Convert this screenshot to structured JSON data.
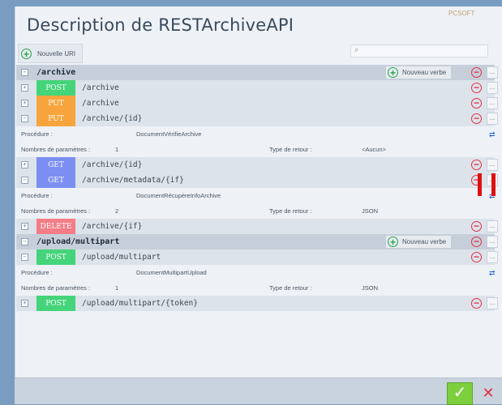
{
  "window": {
    "title": "Description de RESTArchiveAPI",
    "brand": "PCSOFT"
  },
  "toolbar": {
    "new_uri_label": "Nouvelle URI",
    "search_placeholder": ""
  },
  "labels": {
    "add_verb": "Nouveau verbe",
    "procedure": "Procédure :",
    "param_count": "Nombres de paramètres :",
    "return_type": "Type de retour :",
    "dots": "...",
    "expand": "+",
    "collapse": "−"
  },
  "resources": [
    {
      "path": "/archive",
      "verbs": [
        {
          "verb": "POST",
          "color": "#44d47a",
          "path": "/archive",
          "expanded": false
        },
        {
          "verb": "PUT",
          "color": "#f7a43c",
          "path": "/archive",
          "expanded": false
        },
        {
          "verb": "PUT",
          "color": "#f7a43c",
          "path": "/archive/{id}",
          "expanded": true,
          "procedure": "DocumentVérifieArchive",
          "params": "1",
          "return_type": "<Aucun>"
        },
        {
          "verb": "GET",
          "color": "#7b8ef2",
          "path": "/archive/{id}",
          "expanded": false
        },
        {
          "verb": "GET",
          "color": "#7b8ef2",
          "path": "/archive/metadata/{if}",
          "expanded": true,
          "procedure": "DocumentRécupèreInfoArchive",
          "params": "2",
          "return_type": "JSON"
        },
        {
          "verb": "DELETE",
          "color": "#f27d86",
          "path": "/archive/{if}",
          "expanded": false
        }
      ]
    },
    {
      "path": "/upload/multipart",
      "verbs": [
        {
          "verb": "POST",
          "color": "#44d47a",
          "path": "/upload/multipart",
          "expanded": true,
          "procedure": "DocumentMultipartUpload",
          "params": "1",
          "return_type": "JSON"
        },
        {
          "verb": "POST",
          "color": "#44d47a",
          "path": "/upload/multipart/{token}",
          "expanded": false
        }
      ]
    }
  ],
  "footer": {
    "ok_symbol": "✓",
    "cancel_symbol": "✕"
  }
}
